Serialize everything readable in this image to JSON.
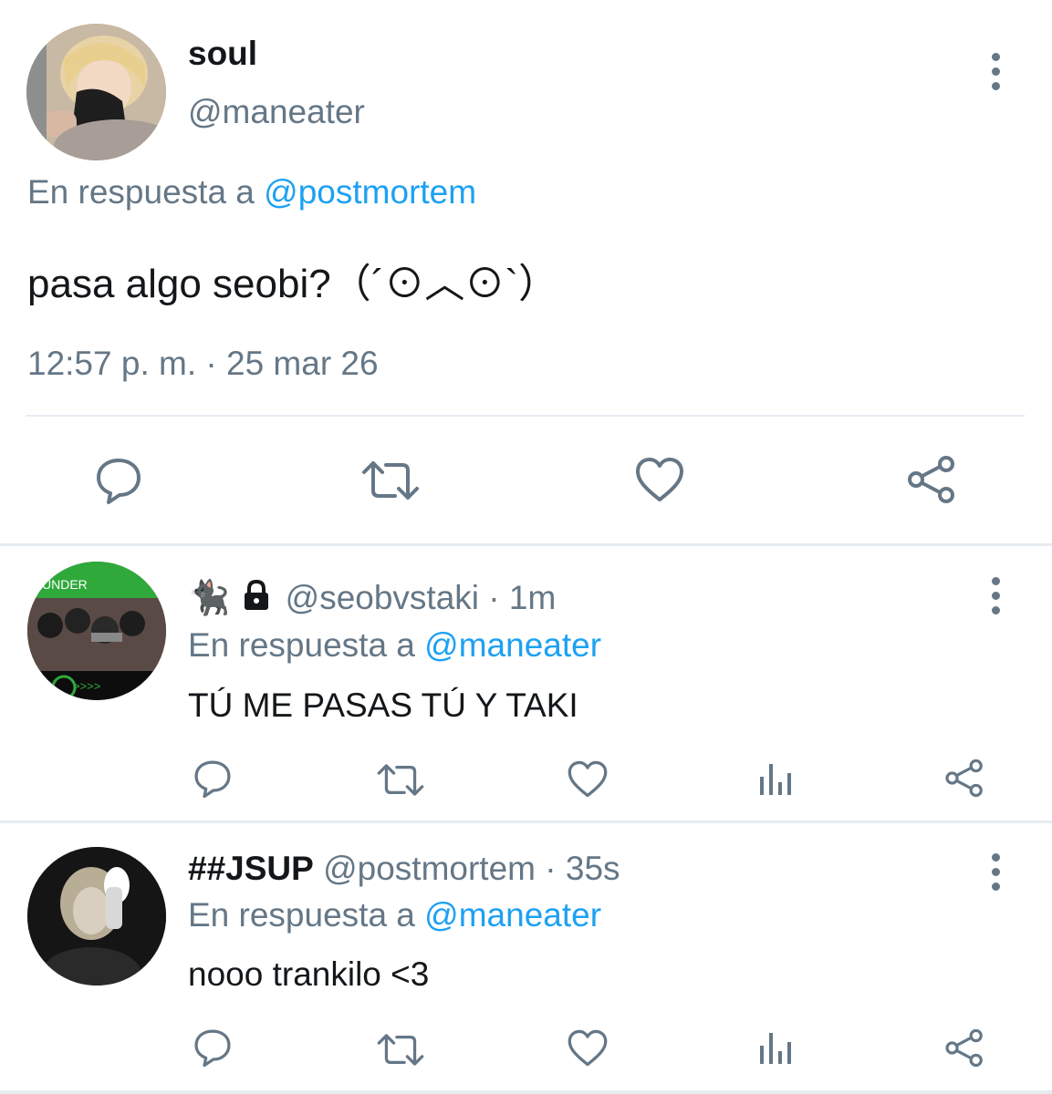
{
  "main_tweet": {
    "display_name": "soul",
    "handle": "@maneater",
    "reply_prefix": "En respuesta a",
    "reply_to": "@postmortem",
    "text": "pasa algo seobi?（´⊙︿⊙`）",
    "timestamp": "12:57 p. m. · 25 mar 26",
    "actions": [
      "reply-icon",
      "retweet-icon",
      "like-icon",
      "share-icon"
    ]
  },
  "replies": [
    {
      "name_emoji": "🐈‍⬛",
      "locked": true,
      "handle": "@seobvstaki",
      "time": " · 1m",
      "reply_prefix": "En respuesta a",
      "reply_to": "@maneater",
      "text": "TÚ ME PASAS TÚ Y TAKI",
      "avatar_text": "UNDER",
      "avatar_arrows": ">>>>",
      "actions": [
        "reply-icon",
        "retweet-icon",
        "like-icon",
        "analytics-icon",
        "share-icon"
      ]
    },
    {
      "display_name": "##JSUP",
      "handle": "@postmortem",
      "time": " · 35s",
      "reply_prefix": "En respuesta a",
      "reply_to": "@maneater",
      "text": "nooo trankilo <3",
      "actions": [
        "reply-icon",
        "retweet-icon",
        "like-icon",
        "analytics-icon",
        "share-icon"
      ]
    }
  ],
  "colors": {
    "link": "#1da1f2",
    "secondary_text": "#657786",
    "icon": "#657786",
    "divider": "#e6ecf0"
  }
}
